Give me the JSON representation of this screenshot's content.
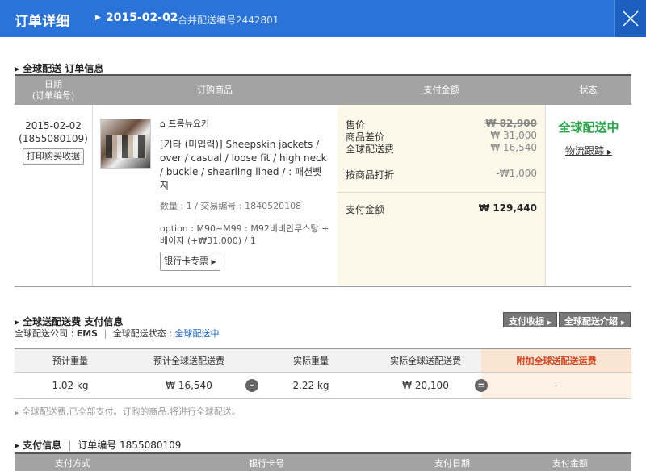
{
  "header": {
    "title": "订单详细",
    "date": "2015-02-02",
    "merge_label": "合并配送编号2442801"
  },
  "order_section": {
    "title": "全球配送 订单信息",
    "columns": [
      "日期\n(订单编号)",
      "订购商品",
      "支付金额",
      "状态"
    ],
    "date": "2015-02-02",
    "order_no": "(1855080109)",
    "print_button": "打印购买收据",
    "shop": "프롬뉴요커",
    "product_name": "[기타 (미입력)] Sheepskin jackets / over / casual / loose fit / high neck / buckle / shearling lined / : 패션뻿지",
    "quantity_line": "数量 : 1 / 交易编号 : 1840520108",
    "option_line": "option : M90~M99 : M92비비안무스탕 + 베이지 (+₩31,000) / 1",
    "card_button": "银行卡专票",
    "payment": [
      {
        "label": "售价",
        "value": "₩ 82,900"
      },
      {
        "label": "商品差价",
        "value": "₩ 31,000"
      },
      {
        "label": "全球配送费",
        "value": "₩ 16,540"
      },
      {
        "label": "按商品打折",
        "value": "-₩1,000"
      }
    ],
    "paid_label": "支付金额",
    "paid_value": "₩ 129,440",
    "status": "全球配送中",
    "track_link": "物流跟踪"
  },
  "shipping_section": {
    "title": "全球送配送费 支付信息",
    "company_label": "全球配送公司 : ",
    "company": "EMS",
    "status_label": "全球配送状态 : ",
    "status": "全球配送中",
    "btn_receipt": "支付收据",
    "btn_intro": "全球配送介绍",
    "headers": [
      "预计重量",
      "预计全球送配送费",
      "实际重量",
      "实际全球送配送费",
      "附加全球送配送运费"
    ],
    "values": [
      "1.02 kg",
      "₩ 16,540",
      "2.22 kg",
      "₩ 20,100",
      "-"
    ],
    "minus_symbol": "-",
    "equals_symbol": "=",
    "note": "全球配送费,已全部支付。订购的商品,将进行全球配送。"
  },
  "payment_section": {
    "title": "支付信息",
    "order_no_label": "订单编号 1855080109",
    "headers": [
      "支付方式",
      "银行卡号",
      "支付日期",
      "支付金额"
    ]
  }
}
